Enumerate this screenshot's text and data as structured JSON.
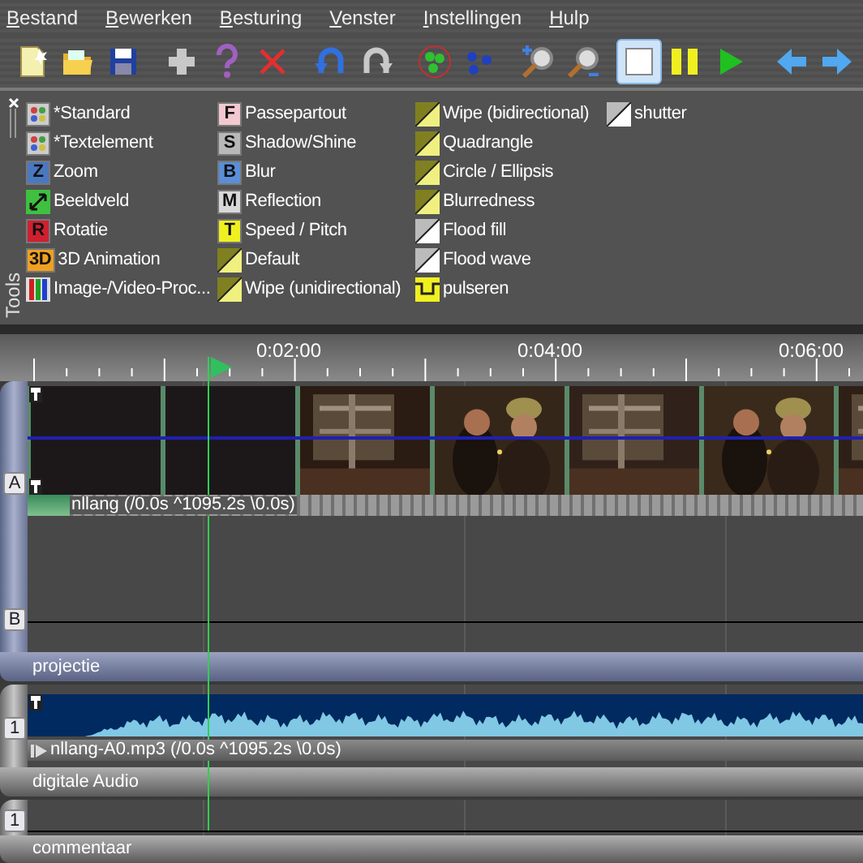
{
  "menu": [
    "Bestand",
    "Bewerken",
    "Besturing",
    "Venster",
    "Instellingen",
    "Hulp"
  ],
  "toolbar": [
    {
      "kind": "new",
      "selected": false
    },
    {
      "kind": "open",
      "selected": false
    },
    {
      "kind": "save",
      "selected": false
    },
    {
      "kind": "add",
      "selected": false
    },
    {
      "kind": "help",
      "selected": false
    },
    {
      "kind": "delete",
      "selected": false
    },
    {
      "kind": "undo",
      "selected": false
    },
    {
      "kind": "redo",
      "selected": false
    },
    {
      "kind": "group",
      "selected": false
    },
    {
      "kind": "ungroup",
      "selected": false
    },
    {
      "kind": "zoom-in",
      "selected": false
    },
    {
      "kind": "zoom-out",
      "selected": false
    },
    {
      "kind": "stop",
      "selected": true
    },
    {
      "kind": "pause",
      "selected": false
    },
    {
      "kind": "play",
      "selected": false
    },
    {
      "kind": "back",
      "selected": false
    },
    {
      "kind": "forward",
      "selected": false
    }
  ],
  "tools": {
    "title": "Tools",
    "columns": [
      [
        {
          "label": "*Standard",
          "kind": "palette"
        },
        {
          "label": "*Textelement",
          "kind": "palette"
        },
        {
          "label": "Zoom",
          "kind": "letter",
          "badge": "Z",
          "color": "#4a78c0"
        },
        {
          "label": "Beeldveld",
          "kind": "arrows"
        },
        {
          "label": "Rotatie",
          "kind": "letter",
          "badge": "R",
          "color": "#d02030"
        },
        {
          "label": "3D Animation",
          "kind": "letter",
          "badge": "3D",
          "color": "#f0a020"
        },
        {
          "label": "Image-/Video-Proc...",
          "kind": "bars"
        }
      ],
      [
        {
          "label": "Passepartout",
          "kind": "letter",
          "badge": "F",
          "color": "#f4c8d0"
        },
        {
          "label": "Shadow/Shine",
          "kind": "letter",
          "badge": "S",
          "color": "#b8b8b8"
        },
        {
          "label": "Blur",
          "kind": "letter",
          "badge": "B",
          "color": "#5a8ed8"
        },
        {
          "label": "Reflection",
          "kind": "letter",
          "badge": "M",
          "color": "#d8d8d8"
        },
        {
          "label": "Speed / Pitch",
          "kind": "letter",
          "badge": "T",
          "color": "#f0f020"
        },
        {
          "label": "Default",
          "kind": "wipe"
        },
        {
          "label": "Wipe (unidirectional)",
          "kind": "wipe"
        }
      ],
      [
        {
          "label": "Wipe (bidirectional)",
          "kind": "wipe"
        },
        {
          "label": "Quadrangle",
          "kind": "wipe"
        },
        {
          "label": "Circle / Ellipsis",
          "kind": "wipe"
        },
        {
          "label": "Blurredness",
          "kind": "wipe"
        },
        {
          "label": "Flood fill",
          "kind": "flood"
        },
        {
          "label": "Flood wave",
          "kind": "flood"
        },
        {
          "label": "pulseren",
          "kind": "pulse"
        }
      ],
      [
        {
          "label": "shutter",
          "kind": "flood"
        }
      ]
    ]
  },
  "ruler": {
    "labels": [
      "0:02:00",
      "0:04:00",
      "0:06:00"
    ]
  },
  "tracks": [
    {
      "kind": "video",
      "name": "projectie",
      "lanes": [
        "A",
        "B"
      ],
      "clip": "nllang (/0.0s ^1095.2s \\0.0s)",
      "frames": [
        {
          "kind": "blank"
        },
        {
          "kind": "blank"
        },
        {
          "kind": "picture"
        },
        {
          "kind": "picture"
        },
        {
          "kind": "picture"
        },
        {
          "kind": "picture"
        },
        {
          "kind": "picture"
        }
      ]
    },
    {
      "kind": "audio",
      "name": "digitale Audio",
      "lanes": [
        "1"
      ],
      "clip": "nllang-A0.mp3 (/0.0s ^1095.2s \\0.0s)"
    },
    {
      "kind": "comment",
      "name": "commentaar",
      "lanes": [
        "1"
      ]
    }
  ]
}
